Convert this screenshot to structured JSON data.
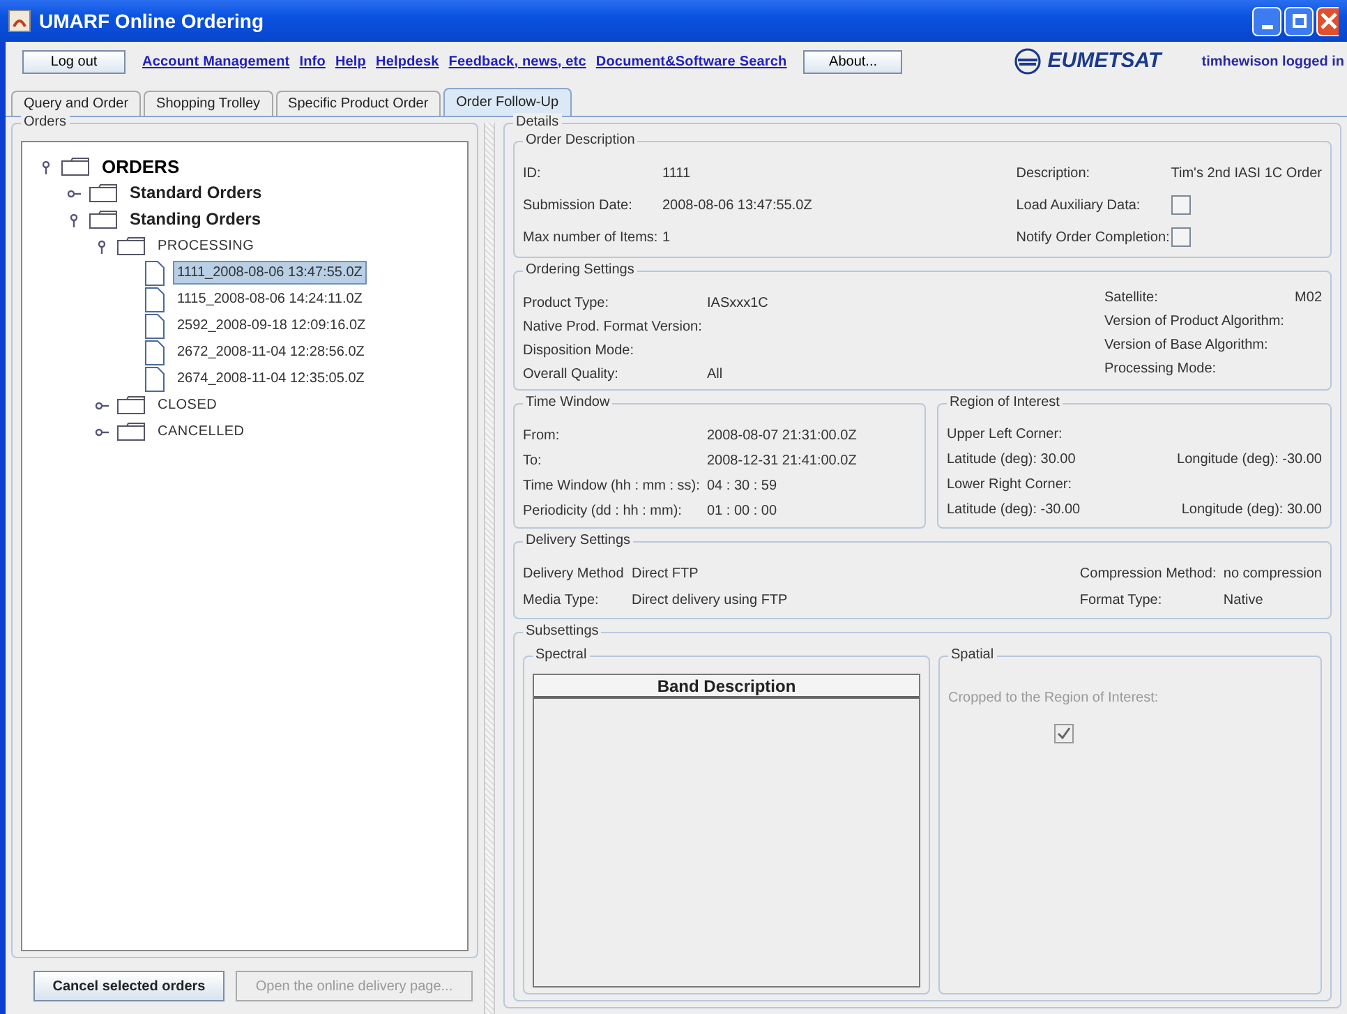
{
  "window": {
    "title": "UMARF Online Ordering"
  },
  "toolbar": {
    "logout": "Log out",
    "links": [
      "Account Management",
      "Info",
      "Help",
      "Helpdesk",
      "Feedback, news, etc",
      "Document&Software Search"
    ],
    "about": "About...",
    "logo": "EUMETSAT",
    "user": "timhewison logged in"
  },
  "tabs": [
    {
      "label": "Query and Order",
      "selected": false
    },
    {
      "label": "Shopping Trolley",
      "selected": false
    },
    {
      "label": "Specific Product Order",
      "selected": false
    },
    {
      "label": "Order Follow-Up",
      "selected": true
    }
  ],
  "orders": {
    "title": "Orders",
    "tree": [
      {
        "label": "ORDERS",
        "kind": "root",
        "expanded": true,
        "children": [
          {
            "label": "Standard Orders",
            "kind": "group",
            "expanded": false
          },
          {
            "label": "Standing Orders",
            "kind": "group",
            "expanded": true,
            "children": [
              {
                "label": "PROCESSING",
                "kind": "status",
                "expanded": true,
                "children": [
                  {
                    "label": "1111_2008-08-06 13:47:55.0Z",
                    "kind": "order",
                    "selected": true
                  },
                  {
                    "label": "1115_2008-08-06 14:24:11.0Z",
                    "kind": "order",
                    "selected": false
                  },
                  {
                    "label": "2592_2008-09-18 12:09:16.0Z",
                    "kind": "order",
                    "selected": false
                  },
                  {
                    "label": "2672_2008-11-04 12:28:56.0Z",
                    "kind": "order",
                    "selected": false
                  },
                  {
                    "label": "2674_2008-11-04 12:35:05.0Z",
                    "kind": "order",
                    "selected": false
                  }
                ]
              },
              {
                "label": "CLOSED",
                "kind": "status",
                "expanded": false
              },
              {
                "label": "CANCELLED",
                "kind": "status",
                "expanded": false
              }
            ]
          }
        ]
      }
    ],
    "buttons": [
      {
        "label": "Cancel selected orders",
        "disabled": false
      },
      {
        "label": "Open the online delivery page...",
        "disabled": true
      }
    ]
  },
  "details": {
    "title": "Details",
    "order_description": {
      "title": "Order Description",
      "left": [
        {
          "label": "ID:",
          "value": "1111"
        },
        {
          "label": "Submission Date:",
          "value": "2008-08-06 13:47:55.0Z"
        },
        {
          "label": "Max number of Items:",
          "value": "1"
        }
      ],
      "right": [
        {
          "label": "Description:",
          "kind": "text",
          "value": "Tim's 2nd IASI 1C Order"
        },
        {
          "label": "Load Auxiliary Data:",
          "kind": "checkbox",
          "checked": false
        },
        {
          "label": "Notify Order Completion:",
          "kind": "checkbox",
          "checked": false
        }
      ]
    },
    "ordering_settings": {
      "title": "Ordering Settings",
      "left": [
        {
          "label": "Product Type:",
          "value": "IASxxx1C"
        },
        {
          "label": "Native Prod. Format Version:"
        },
        {
          "label": "Disposition Mode:"
        },
        {
          "label": "Overall Quality:",
          "value": "All"
        }
      ],
      "right": [
        {
          "label": "Satellite:",
          "value": "M02"
        },
        {
          "label": "Version of Product Algorithm:"
        },
        {
          "label": "Version of Base Algorithm:"
        },
        {
          "label": "Processing Mode:"
        }
      ]
    },
    "time_window": {
      "title": "Time Window",
      "rows": [
        {
          "label": "From:",
          "value": "2008-08-07 21:31:00.0Z"
        },
        {
          "label": "To:",
          "value": "2008-12-31 21:41:00.0Z"
        },
        {
          "label": "Time Window (hh : mm : ss):",
          "value": "04 : 30 : 59"
        },
        {
          "label": "Periodicity (dd : hh : mm):",
          "value": "01 : 00 : 00"
        }
      ]
    },
    "region_of_interest": {
      "title": "Region of Interest",
      "rows": [
        {
          "left": "Upper Left Corner:"
        },
        {
          "left": "Latitude (deg): 30.00",
          "right": "Longitude (deg): -30.00"
        },
        {
          "left": "Lower Right Corner:"
        },
        {
          "left": "Latitude (deg): -30.00",
          "right": "Longitude (deg): 30.00"
        }
      ]
    },
    "delivery_settings": {
      "title": "Delivery Settings",
      "left": [
        {
          "label": "Delivery Method",
          "value": "Direct FTP"
        },
        {
          "label": "Media Type:",
          "value": "Direct delivery using FTP"
        }
      ],
      "right": [
        {
          "label": "Compression Method:",
          "value": "no compression"
        },
        {
          "label": "Format Type:",
          "value": "Native"
        }
      ]
    },
    "subsettings": {
      "title": "Subsettings",
      "spectral": {
        "title": "Spectral",
        "column": "Band Description"
      },
      "spatial": {
        "title": "Spatial",
        "label": "Cropped to the Region of Interest:",
        "checked": true,
        "disabled": true
      }
    }
  }
}
